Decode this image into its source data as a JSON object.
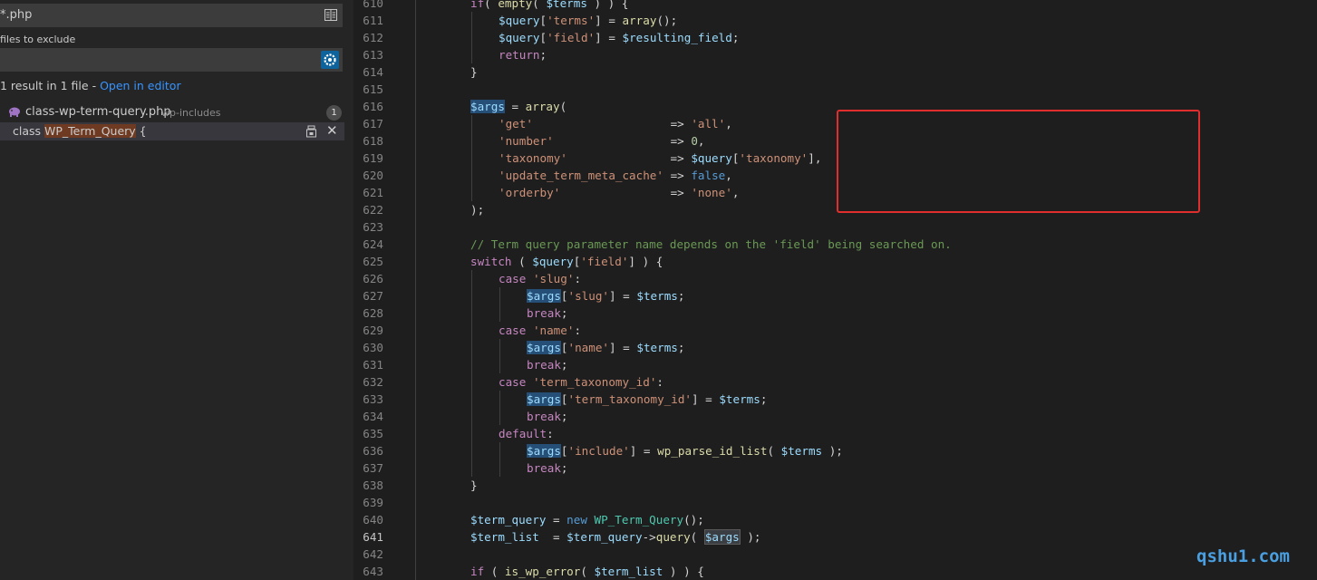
{
  "search": {
    "include_value": "*.php",
    "exclude_label": "files to exclude",
    "exclude_value": "",
    "result_summary": "1 result in 1 file - ",
    "open_in_editor": "Open in editor",
    "file_name": "class-wp-term-query.php",
    "file_dir": "wp-includes",
    "match_count": "1",
    "match_prefix": "class ",
    "match_highlight": "WP_Term_Query",
    "match_suffix": " {",
    "icons": {
      "include_toggle": "book-icon",
      "exclude_settings": "settings-gear-icon",
      "file_type": "php-elephant-icon",
      "replace": "replace-icon",
      "dismiss": "close-icon"
    },
    "colors": {
      "link": "#3794ff",
      "match_highlight": "#6e3b22"
    }
  },
  "editor": {
    "active_line": "641",
    "annotation_color": "#e02d2d",
    "lines": [
      {
        "num": "610",
        "indent": 1,
        "tokens": [
          [
            "kw",
            "if"
          ],
          [
            "",
            "( "
          ],
          [
            "fn",
            "empty"
          ],
          [
            "",
            "( "
          ],
          [
            "vr",
            "$terms"
          ],
          [
            "",
            " ) ) {"
          ]
        ]
      },
      {
        "num": "611",
        "indent": 2,
        "tokens": [
          [
            "vr",
            "$query"
          ],
          [
            "",
            "["
          ],
          [
            "st",
            "'terms'"
          ],
          [
            "",
            "] = "
          ],
          [
            "fn",
            "array"
          ],
          [
            "",
            "();"
          ]
        ]
      },
      {
        "num": "612",
        "indent": 2,
        "tokens": [
          [
            "vr",
            "$query"
          ],
          [
            "",
            "["
          ],
          [
            "st",
            "'field'"
          ],
          [
            "",
            "] = "
          ],
          [
            "vr",
            "$resulting_field"
          ],
          [
            "",
            ";"
          ]
        ]
      },
      {
        "num": "613",
        "indent": 2,
        "tokens": [
          [
            "kw",
            "return"
          ],
          [
            "",
            ";"
          ]
        ]
      },
      {
        "num": "614",
        "indent": 1,
        "tokens": [
          [
            "",
            "}"
          ]
        ]
      },
      {
        "num": "615",
        "indent": 1,
        "tokens": []
      },
      {
        "num": "616",
        "indent": 1,
        "tokens": [
          [
            "vr mark",
            "$args"
          ],
          [
            "",
            " = "
          ],
          [
            "fn",
            "array"
          ],
          [
            "",
            "("
          ]
        ]
      },
      {
        "num": "617",
        "indent": 2,
        "tokens": [
          [
            "st",
            "'get'"
          ],
          [
            "",
            "                    => "
          ],
          [
            "st",
            "'all'"
          ],
          [
            "",
            ","
          ]
        ]
      },
      {
        "num": "618",
        "indent": 2,
        "tokens": [
          [
            "st",
            "'number'"
          ],
          [
            "",
            "                 => "
          ],
          [
            "nm",
            "0"
          ],
          [
            "",
            ","
          ]
        ]
      },
      {
        "num": "619",
        "indent": 2,
        "tokens": [
          [
            "st",
            "'taxonomy'"
          ],
          [
            "",
            "               => "
          ],
          [
            "vr",
            "$query"
          ],
          [
            "",
            "["
          ],
          [
            "st",
            "'taxonomy'"
          ],
          [
            "",
            "],"
          ]
        ]
      },
      {
        "num": "620",
        "indent": 2,
        "tokens": [
          [
            "st",
            "'update_term_meta_cache'"
          ],
          [
            "",
            " => "
          ],
          [
            "bl",
            "false"
          ],
          [
            "",
            ","
          ]
        ]
      },
      {
        "num": "621",
        "indent": 2,
        "tokens": [
          [
            "st",
            "'orderby'"
          ],
          [
            "",
            "                => "
          ],
          [
            "st",
            "'none'"
          ],
          [
            "",
            ","
          ]
        ]
      },
      {
        "num": "622",
        "indent": 1,
        "tokens": [
          [
            "",
            ");"
          ]
        ]
      },
      {
        "num": "623",
        "indent": 1,
        "tokens": []
      },
      {
        "num": "624",
        "indent": 1,
        "tokens": [
          [
            "cm",
            "// Term query parameter name depends on the 'field' being searched on."
          ]
        ]
      },
      {
        "num": "625",
        "indent": 1,
        "tokens": [
          [
            "kw",
            "switch"
          ],
          [
            "",
            " ( "
          ],
          [
            "vr",
            "$query"
          ],
          [
            "",
            "["
          ],
          [
            "st",
            "'field'"
          ],
          [
            "",
            "] ) {"
          ]
        ]
      },
      {
        "num": "626",
        "indent": 2,
        "tokens": [
          [
            "kw",
            "case"
          ],
          [
            "",
            " "
          ],
          [
            "st",
            "'slug'"
          ],
          [
            "",
            ":"
          ]
        ]
      },
      {
        "num": "627",
        "indent": 3,
        "tokens": [
          [
            "vr mark",
            "$args"
          ],
          [
            "",
            "["
          ],
          [
            "st",
            "'slug'"
          ],
          [
            "",
            "] = "
          ],
          [
            "vr",
            "$terms"
          ],
          [
            "",
            ";"
          ]
        ]
      },
      {
        "num": "628",
        "indent": 3,
        "tokens": [
          [
            "kw",
            "break"
          ],
          [
            "",
            ";"
          ]
        ]
      },
      {
        "num": "629",
        "indent": 2,
        "tokens": [
          [
            "kw",
            "case"
          ],
          [
            "",
            " "
          ],
          [
            "st",
            "'name'"
          ],
          [
            "",
            ":"
          ]
        ]
      },
      {
        "num": "630",
        "indent": 3,
        "tokens": [
          [
            "vr mark",
            "$args"
          ],
          [
            "",
            "["
          ],
          [
            "st",
            "'name'"
          ],
          [
            "",
            "] = "
          ],
          [
            "vr",
            "$terms"
          ],
          [
            "",
            ";"
          ]
        ]
      },
      {
        "num": "631",
        "indent": 3,
        "tokens": [
          [
            "kw",
            "break"
          ],
          [
            "",
            ";"
          ]
        ]
      },
      {
        "num": "632",
        "indent": 2,
        "tokens": [
          [
            "kw",
            "case"
          ],
          [
            "",
            " "
          ],
          [
            "st",
            "'term_taxonomy_id'"
          ],
          [
            "",
            ":"
          ]
        ]
      },
      {
        "num": "633",
        "indent": 3,
        "tokens": [
          [
            "vr mark",
            "$args"
          ],
          [
            "",
            "["
          ],
          [
            "st",
            "'term_taxonomy_id'"
          ],
          [
            "",
            "] = "
          ],
          [
            "vr",
            "$terms"
          ],
          [
            "",
            ";"
          ]
        ]
      },
      {
        "num": "634",
        "indent": 3,
        "tokens": [
          [
            "kw",
            "break"
          ],
          [
            "",
            ";"
          ]
        ]
      },
      {
        "num": "635",
        "indent": 2,
        "tokens": [
          [
            "kw",
            "default"
          ],
          [
            "",
            ":"
          ]
        ]
      },
      {
        "num": "636",
        "indent": 3,
        "tokens": [
          [
            "vr mark",
            "$args"
          ],
          [
            "",
            "["
          ],
          [
            "st",
            "'include'"
          ],
          [
            "",
            "] = "
          ],
          [
            "fn",
            "wp_parse_id_list"
          ],
          [
            "",
            "( "
          ],
          [
            "vr",
            "$terms"
          ],
          [
            "",
            " );"
          ]
        ]
      },
      {
        "num": "637",
        "indent": 3,
        "tokens": [
          [
            "kw",
            "break"
          ],
          [
            "",
            ";"
          ]
        ]
      },
      {
        "num": "638",
        "indent": 1,
        "tokens": [
          [
            "",
            "}"
          ]
        ]
      },
      {
        "num": "639",
        "indent": 1,
        "tokens": []
      },
      {
        "num": "640",
        "indent": 1,
        "tokens": [
          [
            "vr",
            "$term_query"
          ],
          [
            "",
            " = "
          ],
          [
            "bl",
            "new"
          ],
          [
            "",
            " "
          ],
          [
            "ty",
            "WP_Term_Query"
          ],
          [
            "",
            "();"
          ]
        ]
      },
      {
        "num": "641",
        "indent": 1,
        "tokens": [
          [
            "vr",
            "$term_list"
          ],
          [
            "",
            "  = "
          ],
          [
            "vr",
            "$term_query"
          ],
          [
            "",
            "->"
          ],
          [
            "fn",
            "query"
          ],
          [
            "",
            "( "
          ],
          [
            "vr mark2",
            "$args"
          ],
          [
            "",
            " );"
          ]
        ]
      },
      {
        "num": "642",
        "indent": 1,
        "tokens": []
      },
      {
        "num": "643",
        "indent": 1,
        "tokens": [
          [
            "kw",
            "if"
          ],
          [
            "",
            " ( "
          ],
          [
            "fn",
            "is_wp_error"
          ],
          [
            "",
            "( "
          ],
          [
            "vr",
            "$term_list"
          ],
          [
            "",
            " ) ) {"
          ]
        ]
      }
    ]
  },
  "watermark": "qshu1.com"
}
